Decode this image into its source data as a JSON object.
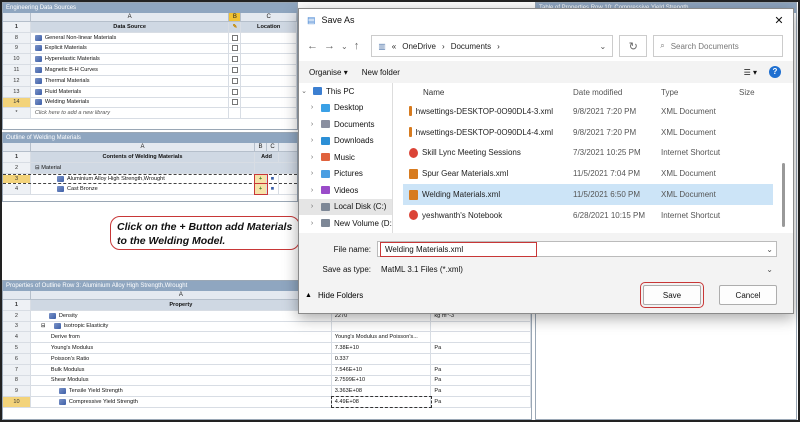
{
  "eds": {
    "title": "Engineering Data Sources",
    "col_a": "A",
    "col_b": "B",
    "col_c": "C",
    "header_row": {
      "num": "1",
      "source": "Data Source",
      "location": "Location"
    },
    "rows": [
      {
        "num": "8",
        "label": "General Non-linear Materials"
      },
      {
        "num": "9",
        "label": "Explicit Materials"
      },
      {
        "num": "10",
        "label": "Hyperelastic Materials"
      },
      {
        "num": "11",
        "label": "Magnetic B-H Curves"
      },
      {
        "num": "12",
        "label": "Thermal Materials"
      },
      {
        "num": "13",
        "label": "Fluid Materials"
      },
      {
        "num": "14",
        "label": "Welding Materials"
      }
    ],
    "add_row": {
      "num": "*",
      "label": "Click here to add a new library"
    }
  },
  "outline": {
    "title": "Outline of Welding Materials",
    "col_a": "A",
    "col_b": "B",
    "col_c": "C",
    "header_row": {
      "num": "1",
      "contents": "Contents of Welding Materials",
      "add": "Add"
    },
    "rows": [
      {
        "num": "2",
        "label": "Material"
      },
      {
        "num": "3",
        "label": "Aluminium Alloy High Strength,Wrought"
      },
      {
        "num": "4",
        "label": "Cast Bronze"
      }
    ]
  },
  "annotation": {
    "line1": "Click on the + Button add Materials",
    "line2": "to the Welding Model."
  },
  "props": {
    "title": "Properties of Outline Row 3: Aluminium Alloy High Strength,Wrought",
    "col_a": "A",
    "header_row": {
      "num": "1",
      "property": "Property"
    },
    "rows": [
      {
        "num": "2",
        "label": "Density",
        "value": "2270",
        "unit": "kg m^-3"
      },
      {
        "num": "3",
        "label": "Isotropic Elasticity",
        "value": "",
        "unit": ""
      },
      {
        "num": "4",
        "label": "Derive from",
        "value": "Young's Modulus and Poisson's...",
        "unit": ""
      },
      {
        "num": "5",
        "label": "Young's Modulus",
        "value": "7.38E+10",
        "unit": "Pa"
      },
      {
        "num": "6",
        "label": "Poisson's Ratio",
        "value": "0.337",
        "unit": ""
      },
      {
        "num": "7",
        "label": "Bulk Modulus",
        "value": "7.546E+10",
        "unit": "Pa"
      },
      {
        "num": "8",
        "label": "Shear Modulus",
        "value": "2.7599E+10",
        "unit": "Pa"
      },
      {
        "num": "9",
        "label": "Tensile Yield Strength",
        "value": "3.363E+08",
        "unit": "Pa"
      },
      {
        "num": "10",
        "label": "Compressive Yield Strength",
        "value": "4.49E+08",
        "unit": "Pa"
      }
    ]
  },
  "right_pane_title": "Table of Properties Row 10: Compressive Yield Strength",
  "dialog": {
    "title": "Save As",
    "close": "✕",
    "path": [
      "OneDrive",
      "Documents"
    ],
    "path_prefix": "«",
    "search_placeholder": "Search Documents",
    "organise": "Organise",
    "new_folder": "New folder",
    "nav": [
      {
        "label": "This PC",
        "color": "#3c7fd1"
      },
      {
        "label": "Desktop",
        "color": "#3aa0e6"
      },
      {
        "label": "Documents",
        "color": "#8a8fa0"
      },
      {
        "label": "Downloads",
        "color": "#2c8fd6"
      },
      {
        "label": "Music",
        "color": "#e0623d"
      },
      {
        "label": "Pictures",
        "color": "#4a9ee2"
      },
      {
        "label": "Videos",
        "color": "#9a4cc9"
      },
      {
        "label": "Local Disk (C:)",
        "color": "#7d8796"
      },
      {
        "label": "New Volume (D:",
        "color": "#7d8796"
      }
    ],
    "columns": {
      "name": "Name",
      "date": "Date modified",
      "type": "Type",
      "size": "Size"
    },
    "files": [
      {
        "name": "hwsettings-DESKTOP-0O90DL4-3.xml",
        "date": "9/8/2021 7:20 PM",
        "type": "XML Document",
        "icon": "#d77b1f"
      },
      {
        "name": "hwsettings-DESKTOP-0O90DL4-4.xml",
        "date": "9/8/2021 7:20 PM",
        "type": "XML Document",
        "icon": "#d77b1f"
      },
      {
        "name": "Skill Lync Meeting Sessions",
        "date": "7/3/2021 10:25 PM",
        "type": "Internet Shortcut",
        "icon": "#db4437"
      },
      {
        "name": "Spur Gear Materials.xml",
        "date": "11/5/2021 7:04 PM",
        "type": "XML Document",
        "icon": "#d77b1f"
      },
      {
        "name": "Welding Materials.xml",
        "date": "11/5/2021 6:50 PM",
        "type": "XML Document",
        "icon": "#d77b1f"
      },
      {
        "name": "yeshwanth's Notebook",
        "date": "6/28/2021 10:15 PM",
        "type": "Internet Shortcut",
        "icon": "#db4437"
      }
    ],
    "file_name_label": "File name:",
    "file_name_value": "Welding Materials.xml",
    "save_type_label": "Save as type:",
    "save_type_value": "MatML 3.1 Files (*.xml)",
    "hide_folders": "Hide Folders",
    "save": "Save",
    "cancel": "Cancel"
  }
}
